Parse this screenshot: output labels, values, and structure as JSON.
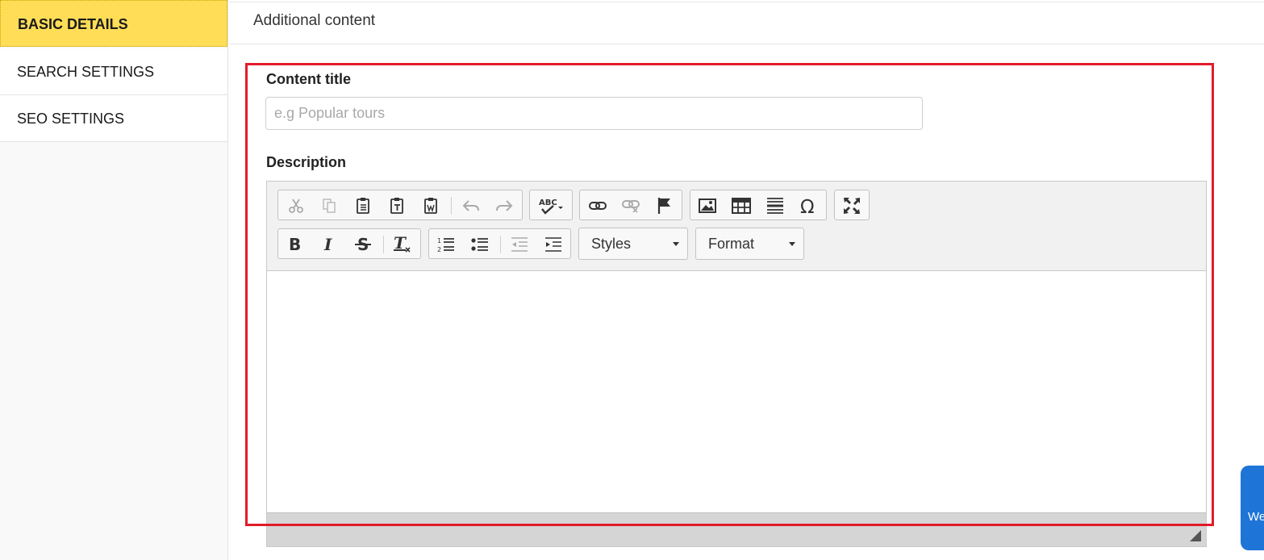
{
  "sidebar": {
    "items": [
      {
        "label": "BASIC DETAILS",
        "active": true
      },
      {
        "label": "SEARCH SETTINGS",
        "active": false
      },
      {
        "label": "SEO SETTINGS",
        "active": false
      }
    ]
  },
  "main": {
    "title": "Additional content"
  },
  "form": {
    "content_title_label": "Content title",
    "content_title_value": "",
    "content_title_placeholder": "e.g Popular tours",
    "description_label": "Description"
  },
  "editor": {
    "toolbar_icons": [
      "cut-icon",
      "copy-icon",
      "paste-icon",
      "paste-text-icon",
      "paste-word-icon",
      "undo-icon",
      "redo-icon",
      "spellcheck-icon",
      "link-icon",
      "unlink-icon",
      "anchor-icon",
      "image-icon",
      "table-icon",
      "horizontal-line-icon",
      "special-char-icon",
      "maximize-icon",
      "bold-icon",
      "italic-icon",
      "strikethrough-icon",
      "remove-format-icon",
      "numbered-list-icon",
      "bulleted-list-icon",
      "outdent-icon",
      "indent-icon"
    ],
    "styles_label": "Styles",
    "format_label": "Format",
    "content": ""
  },
  "chat_widget": {
    "label": "We"
  },
  "colors": {
    "active_tab": "#ffdd57",
    "highlight": "#e21b2a",
    "chat": "#1f74d8"
  }
}
